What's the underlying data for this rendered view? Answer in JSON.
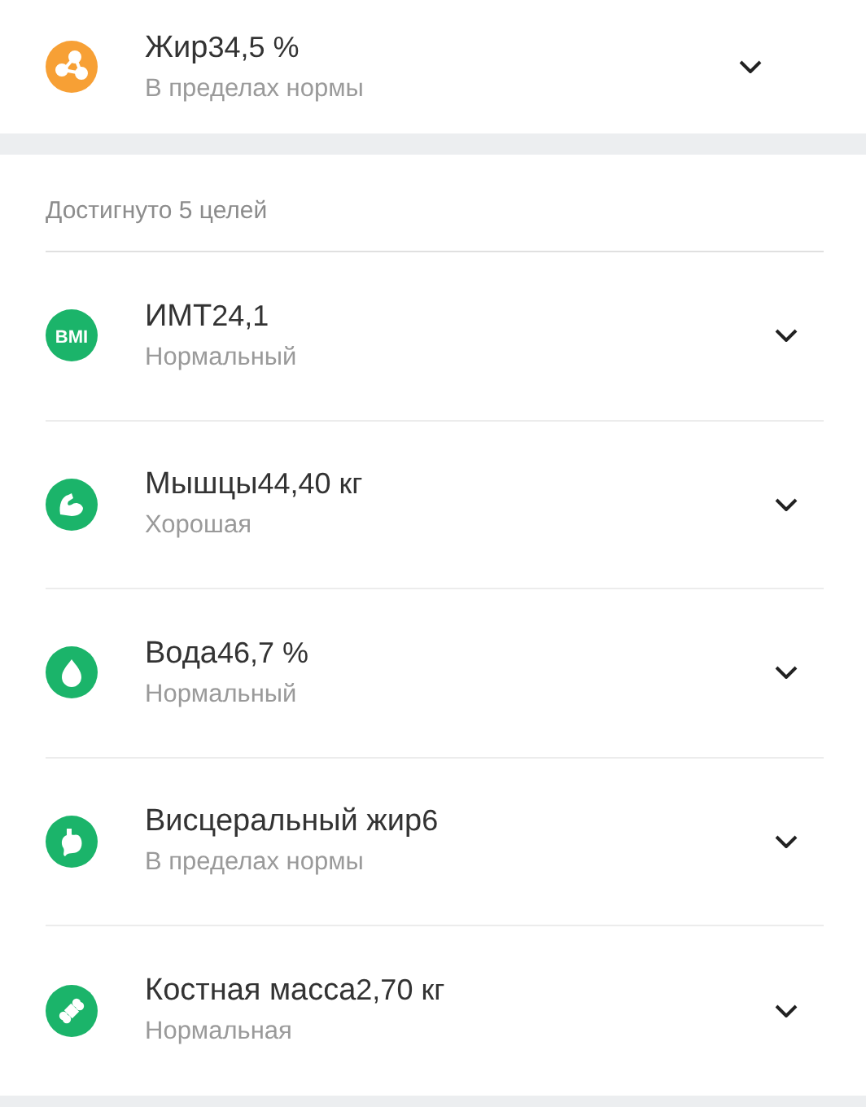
{
  "top_metrics": [
    {
      "kind": "fat",
      "color": "#f7a035",
      "name": "Жир",
      "value": "34,5 %",
      "status": "В пределах нормы",
      "expanded": false
    }
  ],
  "goals": {
    "header": "Достигнуто 5 целей",
    "metrics": [
      {
        "kind": "bmi",
        "color": "#1bb46a",
        "icon_text": "BMI",
        "name": "ИМТ",
        "value": "24,1",
        "status": "Нормальный",
        "expanded": false
      },
      {
        "kind": "muscle",
        "color": "#1bb46a",
        "name": "Мышцы",
        "value": "44,40 кг",
        "status": "Хорошая",
        "expanded": false
      },
      {
        "kind": "water",
        "color": "#1bb46a",
        "name": "Вода",
        "value": "46,7 %",
        "status": "Нормальный",
        "expanded": false
      },
      {
        "kind": "visceral",
        "color": "#1bb46a",
        "name": "Висцеральный жир",
        "value": "6",
        "status": "В пределах нормы",
        "expanded": false
      },
      {
        "kind": "bone",
        "color": "#1bb46a",
        "name": "Костная масса",
        "value": "2,70 кг",
        "status": "Нормальная",
        "expanded": false
      }
    ]
  }
}
